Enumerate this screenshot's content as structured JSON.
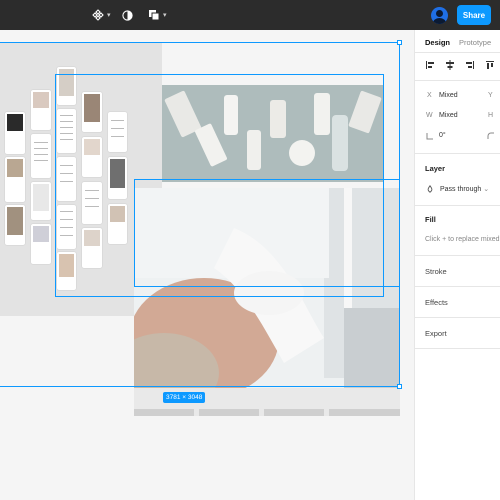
{
  "toolbar": {
    "items": [
      {
        "icon": "component-icon"
      },
      {
        "icon": "contrast-icon"
      },
      {
        "icon": "layers-icon"
      }
    ],
    "share_label": "Share",
    "avatar_icon": "user-avatar-icon"
  },
  "canvas": {
    "selection_size": "3781 × 3048",
    "accent_color": "#0d99ff"
  },
  "panel": {
    "tabs": [
      "Design",
      "Prototype"
    ],
    "position": {
      "x_label": "X",
      "x_value": "Mixed",
      "y_label": "Y",
      "w_label": "W",
      "w_value": "Mixed",
      "h_label": "H",
      "rotation_value": "0°"
    },
    "layer": {
      "title": "Layer",
      "blend_mode": "Pass through"
    },
    "fill": {
      "title": "Fill",
      "hint": "Click + to replace mixed"
    },
    "stroke": {
      "title": "Stroke"
    },
    "effects": {
      "title": "Effects"
    },
    "export": {
      "title": "Export"
    }
  }
}
